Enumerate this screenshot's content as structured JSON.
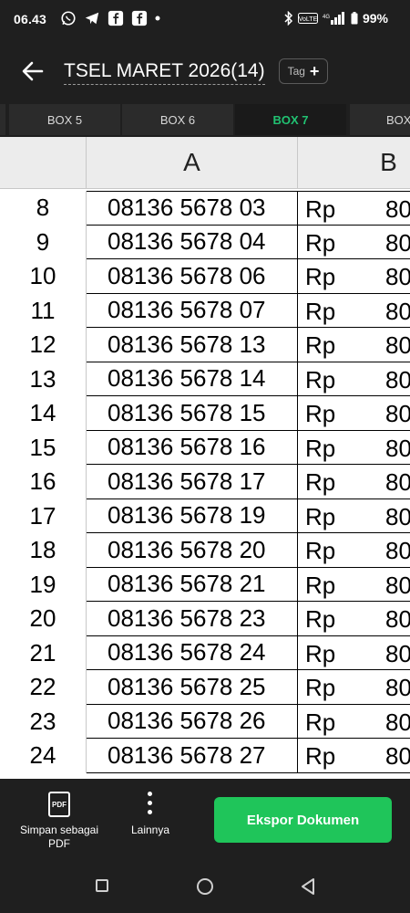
{
  "status_bar": {
    "time": "06.43",
    "icons": [
      "whatsapp-icon",
      "telegram-icon",
      "facebook-icon",
      "facebook-icon",
      "dot-icon"
    ],
    "network": "VoLTE 4G",
    "battery": "99%"
  },
  "app_bar": {
    "title": "TSEL MARET 2026(14)",
    "tag_label": "Tag",
    "tag_plus": "+"
  },
  "tabs": [
    {
      "label": "BOX 5",
      "active": false
    },
    {
      "label": "BOX 6",
      "active": false
    },
    {
      "label": "BOX 7",
      "active": true
    },
    {
      "label": "BOX",
      "active": false
    }
  ],
  "grid": {
    "columns": [
      "A",
      "B"
    ],
    "currency": "Rp",
    "rows": [
      {
        "num": "8",
        "a": "08136 5678 03",
        "b": "80"
      },
      {
        "num": "9",
        "a": "08136 5678 04",
        "b": "80"
      },
      {
        "num": "10",
        "a": "08136 5678 06",
        "b": "80"
      },
      {
        "num": "11",
        "a": "08136 5678 07",
        "b": "80"
      },
      {
        "num": "12",
        "a": "08136 5678 13",
        "b": "80"
      },
      {
        "num": "13",
        "a": "08136 5678 14",
        "b": "80"
      },
      {
        "num": "14",
        "a": "08136 5678 15",
        "b": "80"
      },
      {
        "num": "15",
        "a": "08136 5678 16",
        "b": "80"
      },
      {
        "num": "16",
        "a": "08136 5678 17",
        "b": "80"
      },
      {
        "num": "17",
        "a": "08136 5678 19",
        "b": "80"
      },
      {
        "num": "18",
        "a": "08136 5678 20",
        "b": "80"
      },
      {
        "num": "19",
        "a": "08136 5678 21",
        "b": "80"
      },
      {
        "num": "20",
        "a": "08136 5678 23",
        "b": "80"
      },
      {
        "num": "21",
        "a": "08136 5678 24",
        "b": "80"
      },
      {
        "num": "22",
        "a": "08136 5678 25",
        "b": "80"
      },
      {
        "num": "23",
        "a": "08136 5678 26",
        "b": "80"
      },
      {
        "num": "24",
        "a": "08136 5678 27",
        "b": "80"
      }
    ]
  },
  "bottom_bar": {
    "pdf_icon_text": "PDF",
    "save_pdf_line1": "Simpan sebagai",
    "save_pdf_line2": "PDF",
    "more_label": "Lainnya",
    "export_label": "Ekspor Dokumen"
  },
  "colors": {
    "accent_green": "#1fc55a",
    "active_tab_text": "#21c272",
    "bar_background": "#1f1f1f"
  }
}
